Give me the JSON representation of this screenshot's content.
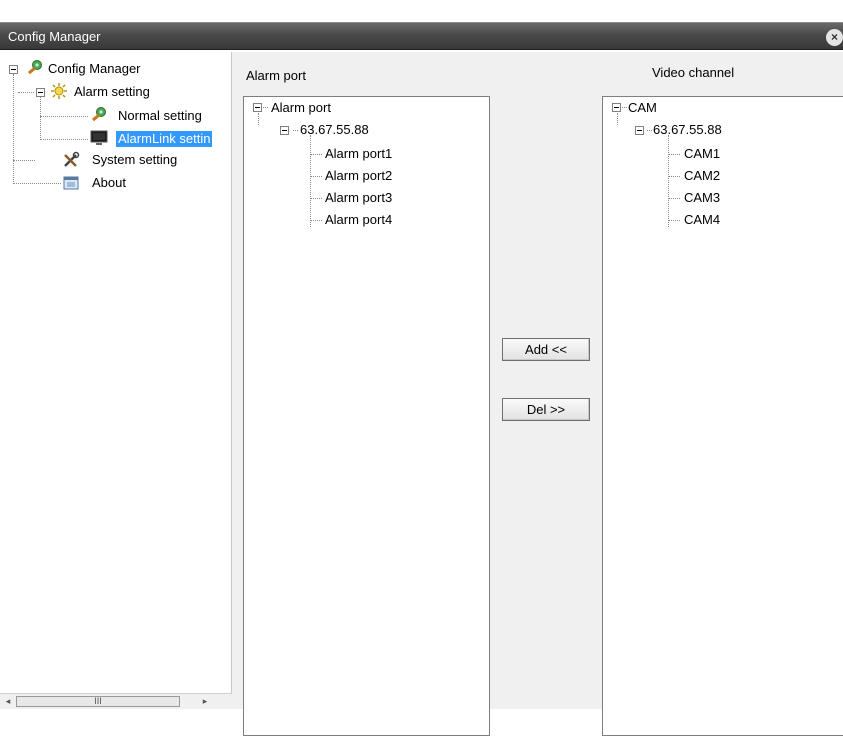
{
  "window": {
    "title": "Config Manager",
    "close_glyph": "×"
  },
  "sidebar": {
    "root": "Config Manager",
    "alarm_setting": "Alarm setting",
    "normal_setting": "Normal setting",
    "alarmlink_setting": "AlarmLink settin",
    "system_setting": "System setting",
    "about": "About",
    "scroll_thumb_glyph": "III",
    "scroll_left_glyph": "◂",
    "scroll_right_glyph": "▸"
  },
  "main": {
    "alarm_port_label": "Alarm port",
    "video_channel_label": "Video channel",
    "alarm_tree": {
      "root": "Alarm port",
      "host": "63.67.55.88",
      "items": [
        "Alarm port1",
        "Alarm port2",
        "Alarm port3",
        "Alarm port4"
      ]
    },
    "video_tree": {
      "root": "CAM",
      "host": "63.67.55.88",
      "items": [
        "CAM1",
        "CAM2",
        "CAM3",
        "CAM4"
      ]
    },
    "add_button": "Add <<",
    "del_button": "Del >>"
  },
  "colors": {
    "selection": "#3399ff",
    "titlebar": "#4a4a4a"
  }
}
